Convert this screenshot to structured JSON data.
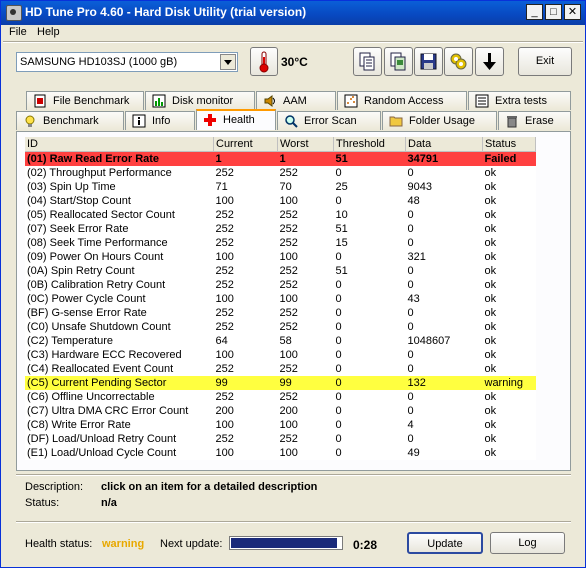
{
  "window": {
    "title": "HD Tune Pro 4.60 - Hard Disk Utility (trial version)"
  },
  "menu": {
    "file": "File",
    "help": "Help"
  },
  "toolbar": {
    "drive": "SAMSUNG HD103SJ (1000 gB)",
    "temperature": "30°C",
    "exit_label": "Exit"
  },
  "tabs_top": [
    "File Benchmark",
    "Disk monitor",
    "AAM",
    "Random Access",
    "Extra tests"
  ],
  "tabs_bottom": [
    "Benchmark",
    "Info",
    "Health",
    "Error Scan",
    "Folder Usage",
    "Erase"
  ],
  "table": {
    "headers": [
      "ID",
      "Current",
      "Worst",
      "Threshold",
      "Data",
      "Status"
    ],
    "rows": [
      [
        "(01) Raw Read Error Rate",
        "1",
        "1",
        "51",
        "34791",
        "Failed"
      ],
      [
        "(02) Throughput Performance",
        "252",
        "252",
        "0",
        "0",
        "ok"
      ],
      [
        "(03) Spin Up Time",
        "71",
        "70",
        "25",
        "9043",
        "ok"
      ],
      [
        "(04) Start/Stop Count",
        "100",
        "100",
        "0",
        "48",
        "ok"
      ],
      [
        "(05) Reallocated Sector Count",
        "252",
        "252",
        "10",
        "0",
        "ok"
      ],
      [
        "(07) Seek Error Rate",
        "252",
        "252",
        "51",
        "0",
        "ok"
      ],
      [
        "(08) Seek Time Performance",
        "252",
        "252",
        "15",
        "0",
        "ok"
      ],
      [
        "(09) Power On Hours Count",
        "100",
        "100",
        "0",
        "321",
        "ok"
      ],
      [
        "(0A) Spin Retry Count",
        "252",
        "252",
        "51",
        "0",
        "ok"
      ],
      [
        "(0B) Calibration Retry Count",
        "252",
        "252",
        "0",
        "0",
        "ok"
      ],
      [
        "(0C) Power Cycle Count",
        "100",
        "100",
        "0",
        "43",
        "ok"
      ],
      [
        "(BF) G-sense Error Rate",
        "252",
        "252",
        "0",
        "0",
        "ok"
      ],
      [
        "(C0) Unsafe Shutdown Count",
        "252",
        "252",
        "0",
        "0",
        "ok"
      ],
      [
        "(C2) Temperature",
        "64",
        "58",
        "0",
        "1048607",
        "ok"
      ],
      [
        "(C3) Hardware ECC Recovered",
        "100",
        "100",
        "0",
        "0",
        "ok"
      ],
      [
        "(C4) Reallocated Event Count",
        "252",
        "252",
        "0",
        "0",
        "ok"
      ],
      [
        "(C5) Current Pending Sector",
        "99",
        "99",
        "0",
        "132",
        "warning"
      ],
      [
        "(C6) Offline Uncorrectable",
        "252",
        "252",
        "0",
        "0",
        "ok"
      ],
      [
        "(C7) Ultra DMA CRC Error Count",
        "200",
        "200",
        "0",
        "0",
        "ok"
      ],
      [
        "(C8) Write Error Rate",
        "100",
        "100",
        "0",
        "4",
        "ok"
      ],
      [
        "(DF) Load/Unload Retry Count",
        "252",
        "252",
        "0",
        "0",
        "ok"
      ],
      [
        "(E1) Load/Unload Cycle Count",
        "100",
        "100",
        "0",
        "49",
        "ok"
      ]
    ]
  },
  "details": {
    "description_label": "Description:",
    "description_value": "click on an item for a detailed description",
    "status_label": "Status:",
    "status_value": "n/a"
  },
  "footer": {
    "health_label": "Health status:",
    "health_value": "warning",
    "health_color": "#e8a800",
    "next_update_label": "Next update:",
    "progress_fraction": 0.96,
    "countdown": "0:28",
    "update_label": "Update",
    "log_label": "Log"
  }
}
